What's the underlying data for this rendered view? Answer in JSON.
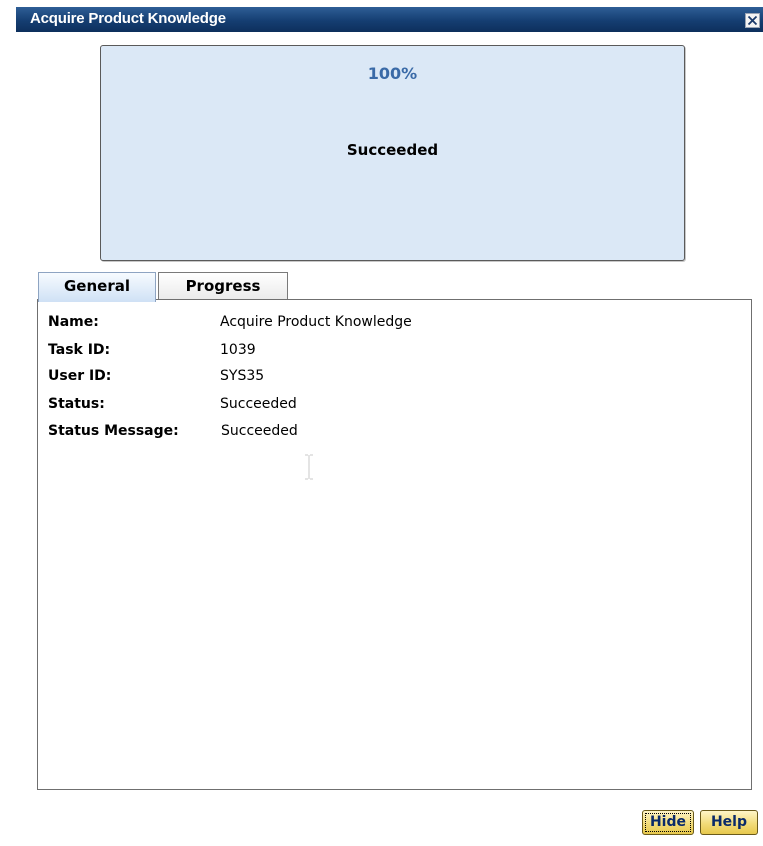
{
  "dialog": {
    "title": "Acquire Product Knowledge"
  },
  "progress": {
    "percent_text": "100%",
    "percent_value": 100,
    "status_text": "Succeeded"
  },
  "tabs": [
    {
      "label": "General",
      "selected": true
    },
    {
      "label": "Progress",
      "selected": false
    }
  ],
  "general": {
    "fields": [
      {
        "label": "Name:",
        "value": "Acquire Product Knowledge"
      },
      {
        "label": "Task ID:",
        "value": "1039"
      },
      {
        "label": "User ID:",
        "value": "SYS35"
      },
      {
        "label": "Status:",
        "value": "Succeeded"
      },
      {
        "label": "Status Message:",
        "value": "Succeeded"
      }
    ]
  },
  "buttons": {
    "hide_label": "Hide",
    "help_label": "Help"
  },
  "colors": {
    "titlebar": "#153e72",
    "progress_panel": "#dbe8f6",
    "percent_text": "#3a6aa7",
    "button_fill": "#f2dc7a"
  },
  "icons": {
    "close": "close-icon",
    "cursor": "text-cursor-icon"
  }
}
